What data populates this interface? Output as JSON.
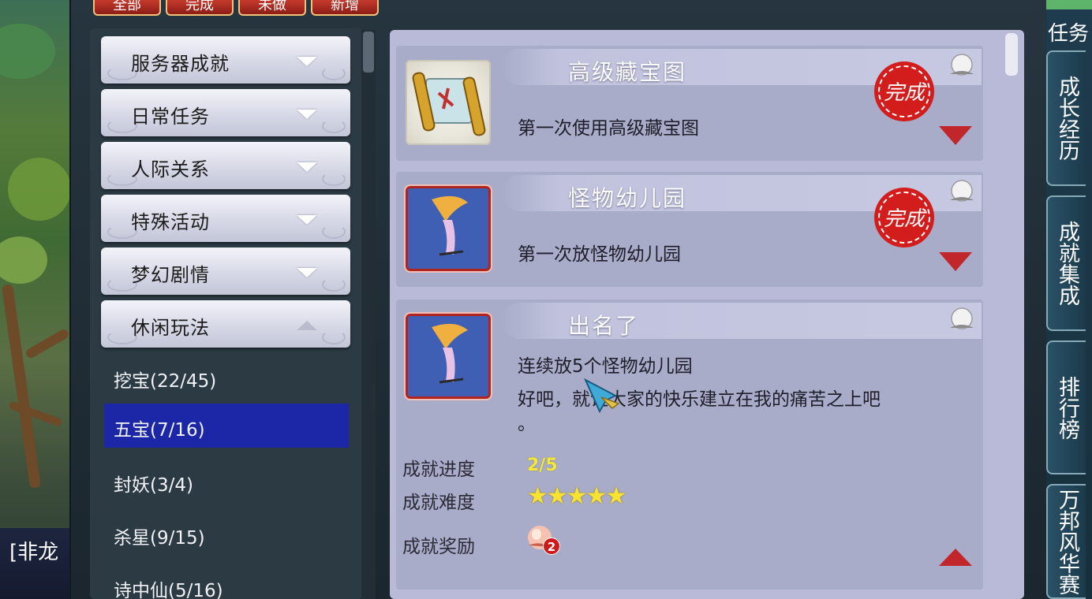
{
  "filter_tabs": [
    "全部",
    "完成",
    "未做",
    "新增"
  ],
  "categories": [
    {
      "label": "服务器成就",
      "expanded": false
    },
    {
      "label": "日常任务",
      "expanded": false
    },
    {
      "label": "人际关系",
      "expanded": false
    },
    {
      "label": "特殊活动",
      "expanded": false
    },
    {
      "label": "梦幻剧情",
      "expanded": false
    },
    {
      "label": "休闲玩法",
      "expanded": true
    }
  ],
  "subcategories": [
    {
      "label": "挖宝(22/45)",
      "selected": false
    },
    {
      "label": "五宝(7/16)",
      "selected": true
    },
    {
      "label": "封妖(3/4)",
      "selected": false
    },
    {
      "label": "杀星(9/15)",
      "selected": false
    },
    {
      "label": "诗中仙(5/16)",
      "selected": false
    }
  ],
  "achievements": [
    {
      "title": "高级藏宝图",
      "description": "第一次使用高级藏宝图",
      "completed": true,
      "stamp_text": "完成",
      "icon": "treasure-map-scroll-icon"
    },
    {
      "title": "怪物幼儿园",
      "description": "第一次放怪物幼儿园",
      "completed": true,
      "stamp_text": "完成",
      "icon": "monster-kindergarten-icon"
    },
    {
      "title": "出名了",
      "description_lines": [
        "连续放5个怪物幼儿园",
        "好吧，就让大家的快乐建立在我的痛苦之上吧",
        "。"
      ],
      "completed": false,
      "icon": "monster-kindergarten-icon",
      "details": {
        "progress_label": "成就进度",
        "progress_value": "2/5",
        "difficulty_label": "成就难度",
        "difficulty_stars": "★★★★★",
        "difficulty_level": 5,
        "reward_label": "成就奖励",
        "reward_count": "2",
        "reward_icon": "peach-icon"
      }
    }
  ],
  "side_tabs": [
    "成长经历",
    "成就集成",
    "排行榜",
    "万邦风华赛"
  ],
  "side_top_label": "任务",
  "scenery_label": "[非龙",
  "colors": {
    "selected_row": "#1c27a8",
    "stamp_red": "#c1262a",
    "progress_yellow": "#f4e93a",
    "panel_lavender": "#b8bad8"
  }
}
